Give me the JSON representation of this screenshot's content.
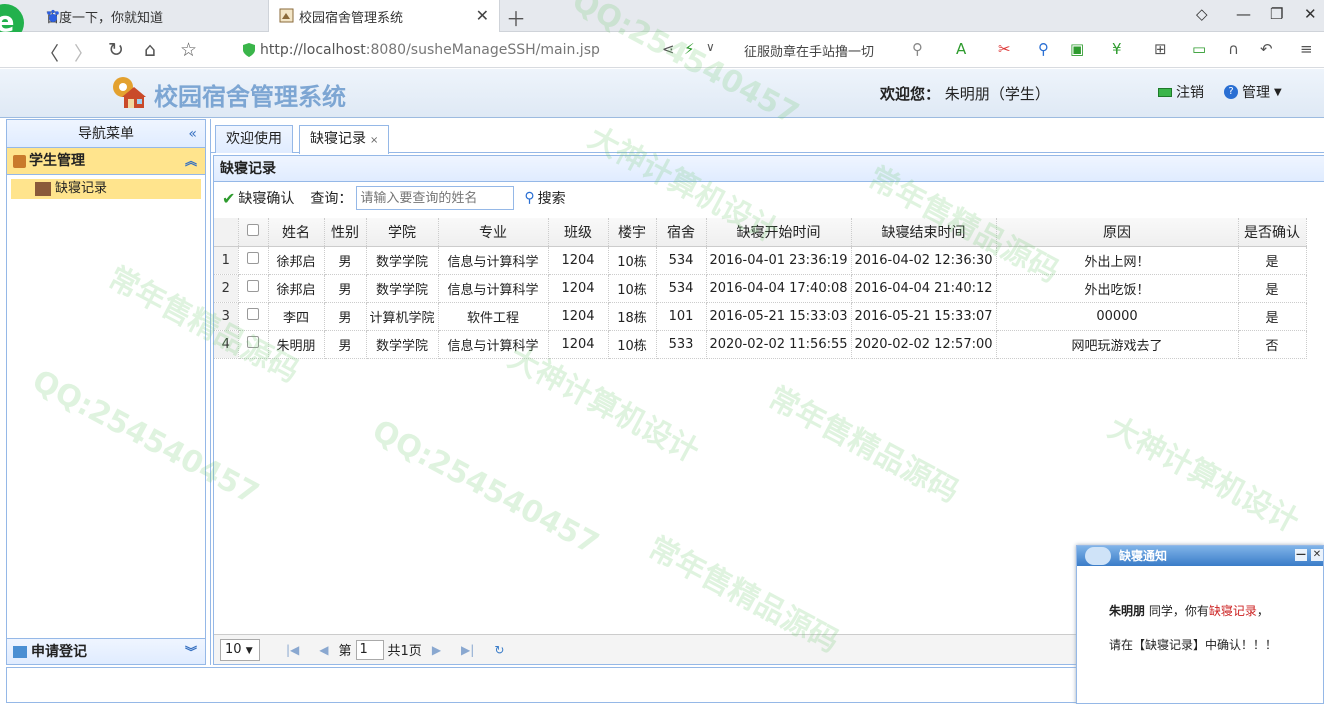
{
  "browser": {
    "tab1_title": "百度一下，你就知道",
    "tab2_title": "校园宿舍管理系统",
    "url_host": "http://localhost",
    "url_rest": ":8080/susheManageSSH/main.jsp",
    "search_suggest": "征服勋章在手站撸一切"
  },
  "header": {
    "system_title": "校园宿舍管理系统",
    "welcome_label": "欢迎您：",
    "user_name": "朱明朋",
    "user_role": "（学生）",
    "logout_label": "注销",
    "manage_label": "管理"
  },
  "sidebar": {
    "title": "导航菜单",
    "section1": "学生管理",
    "item1": "缺寝记录",
    "section2": "申请登记"
  },
  "content_tabs": {
    "tab1": "欢迎使用",
    "tab2": "缺寝记录"
  },
  "panel": {
    "title": "缺寝记录",
    "confirm_button": "缺寝确认",
    "query_label": "查询：",
    "query_placeholder": "请输入要查询的姓名",
    "search_button": "搜索"
  },
  "table": {
    "columns": [
      "姓名",
      "性别",
      "学院",
      "专业",
      "班级",
      "楼宇",
      "宿舍",
      "缺寝开始时间",
      "缺寝结束时间",
      "原因",
      "是否确认"
    ],
    "rows": [
      {
        "n": "1",
        "name": "徐邦启",
        "sex": "男",
        "college": "数学学院",
        "major": "信息与计算科学",
        "cls": "1204",
        "bld": "10栋",
        "room": "534",
        "start": "2016-04-01 23:36:19",
        "end": "2016-04-02 12:36:30",
        "reason": "外出上网！",
        "confirmed": "是"
      },
      {
        "n": "2",
        "name": "徐邦启",
        "sex": "男",
        "college": "数学学院",
        "major": "信息与计算科学",
        "cls": "1204",
        "bld": "10栋",
        "room": "534",
        "start": "2016-04-04 17:40:08",
        "end": "2016-04-04 21:40:12",
        "reason": "外出吃饭！",
        "confirmed": "是"
      },
      {
        "n": "3",
        "name": "李四",
        "sex": "男",
        "college": "计算机学院",
        "major": "软件工程",
        "cls": "1204",
        "bld": "18栋",
        "room": "101",
        "start": "2016-05-21 15:33:03",
        "end": "2016-05-21 15:33:07",
        "reason": "00000",
        "confirmed": "是"
      },
      {
        "n": "4",
        "name": "朱明朋",
        "sex": "男",
        "college": "数学学院",
        "major": "信息与计算科学",
        "cls": "1204",
        "bld": "10栋",
        "room": "533",
        "start": "2020-02-02 11:56:55",
        "end": "2020-02-02 12:57:00",
        "reason": "网吧玩游戏去了",
        "confirmed": "否"
      }
    ]
  },
  "pager": {
    "page_size": "10",
    "page_prefix": "第",
    "page_num": "1",
    "page_total": "共1页"
  },
  "notification": {
    "title": "缺寝通知",
    "name": "朱明朋",
    "line1_mid": " 同学，你有",
    "line1_link": "缺寝记录",
    "line1_end": "，",
    "line2": "请在【缺寝记录】中确认！！！"
  },
  "watermarks": [
    "QQ:254540457",
    "常年售精品源码",
    "大神计算机设计"
  ]
}
